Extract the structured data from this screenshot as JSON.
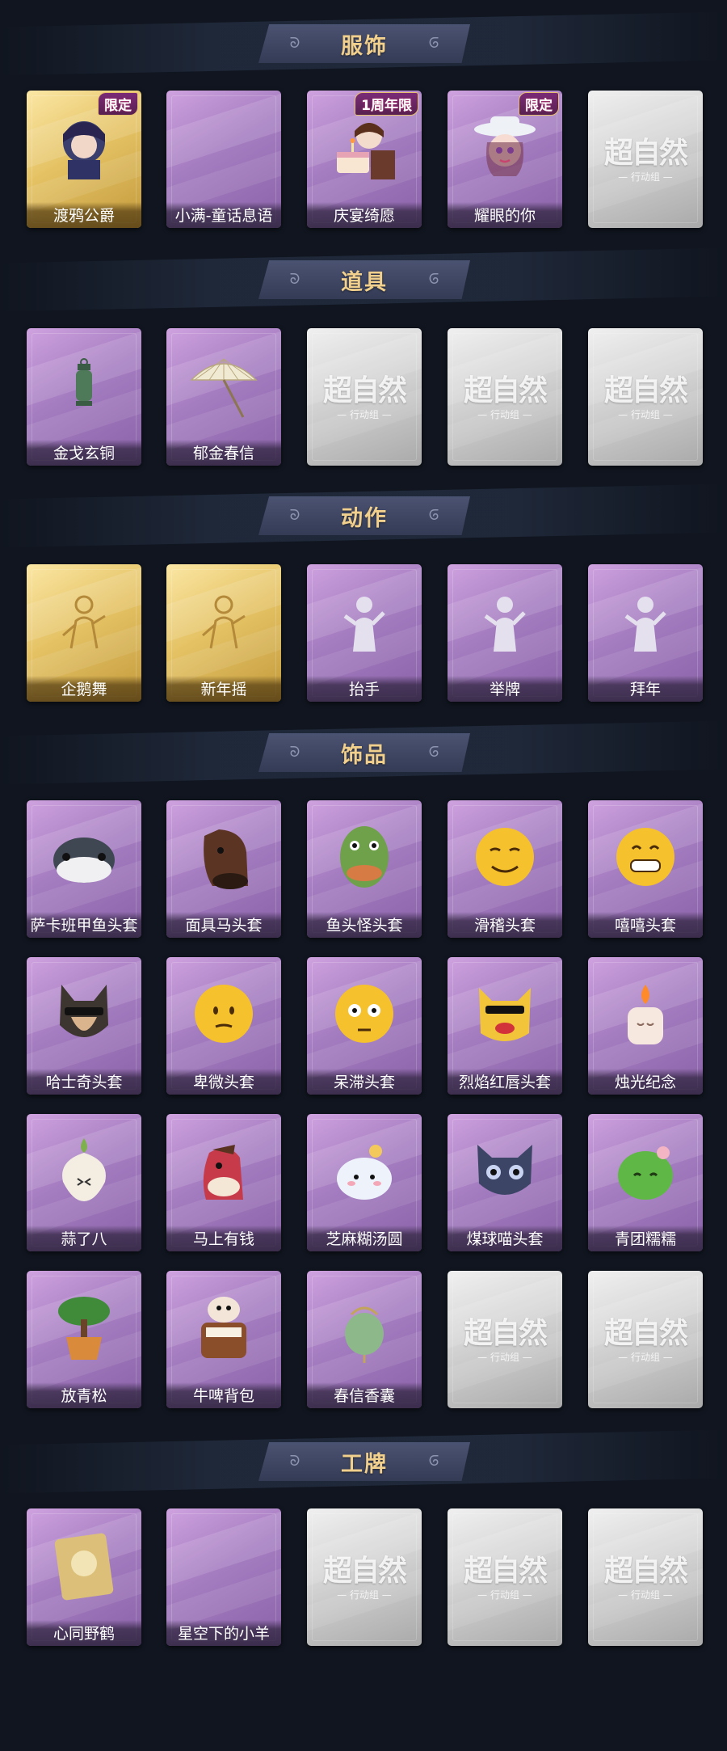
{
  "placeholder": {
    "logo_main": "超自然",
    "logo_sub": "— 行动组 —"
  },
  "sections": [
    {
      "title": "服饰",
      "rows": [
        [
          {
            "label": "渡鸦公爵",
            "style": "gold",
            "icon": "character-icon",
            "badge": "限定"
          },
          {
            "label": "小满-童话息语",
            "style": "purple",
            "icon": "empty"
          },
          {
            "label": "庆宴绮愿",
            "style": "purple",
            "icon": "character-cake-icon",
            "badge": "1周年限"
          },
          {
            "label": "耀眼的你",
            "style": "purple",
            "icon": "character-hat-icon",
            "badge": "限定"
          },
          {
            "label": "",
            "style": "gray",
            "icon": "placeholder-logo"
          }
        ]
      ]
    },
    {
      "title": "道具",
      "rows": [
        [
          {
            "label": "金戈玄铜",
            "style": "purple",
            "icon": "lantern-icon"
          },
          {
            "label": "郁金春信",
            "style": "purple",
            "icon": "umbrella-icon"
          },
          {
            "label": "",
            "style": "gray",
            "icon": "placeholder-logo"
          },
          {
            "label": "",
            "style": "gray",
            "icon": "placeholder-logo"
          },
          {
            "label": "",
            "style": "gray",
            "icon": "placeholder-logo"
          }
        ]
      ]
    },
    {
      "title": "动作",
      "rows": [
        [
          {
            "label": "企鹅舞",
            "style": "gold",
            "icon": "dance-pose-icon"
          },
          {
            "label": "新年摇",
            "style": "gold",
            "icon": "wave-pose-icon"
          },
          {
            "label": "抬手",
            "style": "purple",
            "icon": "raise-hand-icon"
          },
          {
            "label": "举牌",
            "style": "purple",
            "icon": "sign-pose-icon"
          },
          {
            "label": "拜年",
            "style": "purple",
            "icon": "greeting-pose-icon"
          }
        ]
      ]
    },
    {
      "title": "饰品",
      "rows": [
        [
          {
            "label": "萨卡班甲鱼头套",
            "style": "purple",
            "icon": "fish-mask-icon"
          },
          {
            "label": "面具马头套",
            "style": "purple",
            "icon": "horse-mask-icon"
          },
          {
            "label": "鱼头怪头套",
            "style": "purple",
            "icon": "frog-fish-mask-icon"
          },
          {
            "label": "滑稽头套",
            "style": "purple",
            "icon": "smirk-emoji-icon"
          },
          {
            "label": "嘻嘻头套",
            "style": "purple",
            "icon": "grin-emoji-icon"
          }
        ],
        [
          {
            "label": "哈士奇头套",
            "style": "purple",
            "icon": "husky-mask-icon"
          },
          {
            "label": "卑微头套",
            "style": "purple",
            "icon": "humble-emoji-icon"
          },
          {
            "label": "呆滞头套",
            "style": "purple",
            "icon": "stare-emoji-icon"
          },
          {
            "label": "烈焰红唇头套",
            "style": "purple",
            "icon": "yellow-creature-mask-icon"
          },
          {
            "label": "烛光纪念",
            "style": "purple",
            "icon": "candle-icon"
          }
        ],
        [
          {
            "label": "蒜了八",
            "style": "purple",
            "icon": "garlic-icon"
          },
          {
            "label": "马上有钱",
            "style": "purple",
            "icon": "red-horse-icon"
          },
          {
            "label": "芝麻糊汤圆",
            "style": "purple",
            "icon": "dumpling-icon"
          },
          {
            "label": "煤球喵头套",
            "style": "purple",
            "icon": "cat-mask-icon"
          },
          {
            "label": "青团糯糯",
            "style": "purple",
            "icon": "green-rice-ball-icon"
          }
        ],
        [
          {
            "label": "放青松",
            "style": "purple",
            "icon": "bonsai-icon"
          },
          {
            "label": "牛啤背包",
            "style": "purple",
            "icon": "cow-backpack-icon"
          },
          {
            "label": "春信香囊",
            "style": "purple",
            "icon": "sachet-icon"
          },
          {
            "label": "",
            "style": "gray",
            "icon": "placeholder-logo"
          },
          {
            "label": "",
            "style": "gray",
            "icon": "placeholder-logo"
          }
        ]
      ]
    },
    {
      "title": "工牌",
      "rows": [
        [
          {
            "label": "心同野鹤",
            "style": "purple",
            "icon": "golden-card-icon"
          },
          {
            "label": "星空下的小羊",
            "style": "purple",
            "icon": "empty"
          },
          {
            "label": "",
            "style": "gray",
            "icon": "placeholder-logo"
          },
          {
            "label": "",
            "style": "gray",
            "icon": "placeholder-logo"
          },
          {
            "label": "",
            "style": "gray",
            "icon": "placeholder-logo"
          }
        ]
      ]
    }
  ],
  "swirl_glyph": "ᘐ",
  "colors": {
    "background": "#10151f",
    "header": "#3f4663",
    "title": "#f1cf8c",
    "purple_card": "#a47cc0",
    "gold_card": "#e5c365",
    "gray_card": "#cfcfcf"
  }
}
